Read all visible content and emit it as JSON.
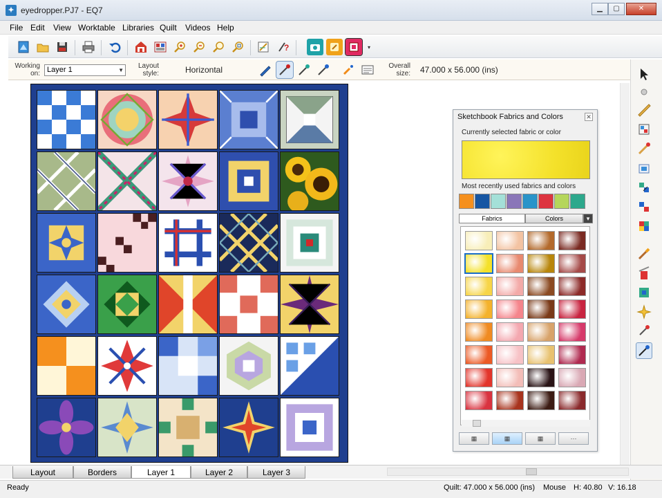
{
  "window": {
    "title": "eyedropper.PJ7 - EQ7",
    "app_icon": "eq7-app-icon",
    "controls": [
      "minimize",
      "maximize",
      "close"
    ]
  },
  "menu": [
    "File",
    "Edit",
    "View",
    "Worktable",
    "Libraries",
    "Quilt",
    "Videos",
    "Help"
  ],
  "toolbar": {
    "icons": [
      "new-project-icon",
      "open-icon",
      "save-icon",
      "print-icon",
      "undo-icon",
      "worktable-quilt-icon",
      "view-sketchbook-icon",
      "zoom-in-icon",
      "zoom-out-icon",
      "refresh-zoom-icon",
      "fit-to-worktable-icon",
      "edit-sketchbook-icon",
      "help-icon",
      "camera-icon",
      "tool-yellow-icon",
      "fabric-tool-icon"
    ]
  },
  "properties": {
    "working_on_label_1": "Working",
    "working_on_label_2": "on:",
    "working_on_value": "Layer 1",
    "layout_style_label_1": "Layout",
    "layout_style_label_2": "style:",
    "layout_style_value": "Horizontal",
    "overall_size_label_1": "Overall",
    "overall_size_label_2": "size:",
    "overall_size_value": "47.000 x 56.000 (ins)"
  },
  "sketchbook_panel": {
    "title": "Sketchbook Fabrics and Colors",
    "current_label": "Currently selected fabric or color",
    "current_color": "#f4e12a",
    "recent_label": "Most recently used fabrics and colors",
    "recent_colors": [
      "#f5901e",
      "#1656a3",
      "#a4e0d8",
      "#8a76b8",
      "#2a94c9",
      "#dd3440",
      "#b5d65b",
      "#2da88c"
    ],
    "tab_fabrics": "Fabrics",
    "tab_colors": "Colors",
    "active_tab": "Fabrics",
    "palette_columns": [
      [
        "#f8eeb8",
        "#f4e12a",
        "#f7d548",
        "#f4b22c",
        "#f08b22",
        "#ec5a25",
        "#e3352c",
        "#d93340"
      ],
      [
        "#f3c3a2",
        "#e88a70",
        "#f3aaa8",
        "#f5858c",
        "#f4a8b0",
        "#f7c2c6",
        "#f3bdb8",
        "#a8341e"
      ],
      [
        "#b36a2c",
        "#b8860b",
        "#8b4a22",
        "#7a3a18",
        "#d8a36a",
        "#e8c270",
        "#2a1416",
        "#3c1c14"
      ],
      [
        "#7a2a22",
        "#a54a48",
        "#8c2a28",
        "#c82440",
        "#d63a6a",
        "#b02a50",
        "#d9a8b4",
        "#8a2a2c"
      ]
    ],
    "view_icons": [
      "large-swatch-icon",
      "medium-swatch-icon",
      "small-swatch-icon",
      "tiny-swatch-icon"
    ]
  },
  "right_tools": [
    "select-arrow-icon",
    "adjust-tool-icon",
    "ruler-icon",
    "set-block-icon",
    "paintbrush-icon",
    "spraycan-icon",
    "swap-all-icon",
    "swap-alternate-icon",
    "symmetry-icon",
    "brush-icon",
    "tilt-icon",
    "fabric-fill-icon",
    "eyedropper-icon",
    "rotate-icon"
  ],
  "tabs": [
    "Layout",
    "Borders",
    "Layer 1",
    "Layer 2",
    "Layer 3"
  ],
  "active_tab": "Layer 1",
  "status": {
    "left": "Ready",
    "quilt": "Quilt: 47.000 x 56.000 (ins)",
    "mouse": "Mouse",
    "h": "H: 40.80",
    "v": "V: 16.18"
  },
  "quilt": {
    "border_color": "#1f3f8f",
    "blocks": [
      "nine-patch",
      "tumbling-blocks",
      "eight-point-star",
      "box-block",
      "pinwheel-squares",
      "diagonal-lattice",
      "trip-around-world",
      "lemoyne-star",
      "bear-paw",
      "sunflower-photo",
      "sawtooth-star",
      "checkerboard",
      "chain-link",
      "lattice-weave",
      "log-cabin",
      "spider-web",
      "woven-star",
      "x-block",
      "ohio-star",
      "dahlia-star",
      "orange-squares",
      "mariner-compass",
      "blue-squares",
      "hexagon-patch",
      "triangle-patch",
      "flower-petals",
      "star-medallion",
      "checker-patch",
      "lone-star",
      "square-in-square"
    ]
  }
}
